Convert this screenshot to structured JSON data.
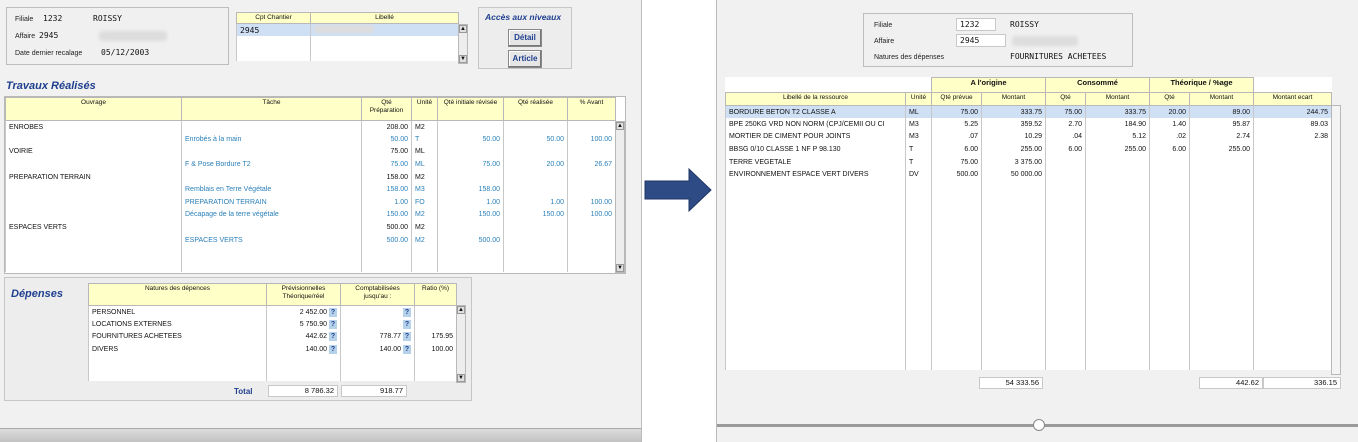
{
  "left": {
    "header": {
      "filiale_label": "Filiale",
      "filiale_code": "1232",
      "filiale_name": "ROISSY",
      "affaire_label": "Affaire",
      "affaire_code": "2945",
      "recalage_label": "Date dernier recalage",
      "recalage_date": "05/12/2003"
    },
    "chantier_table": {
      "columns": [
        "Cpt Chantier",
        "Libellé"
      ],
      "rows": [
        {
          "code": "2945"
        }
      ]
    },
    "acces": {
      "title": "Accès aux niveaux",
      "detail_button": "Détail",
      "article_button": "Article"
    },
    "travaux": {
      "title": "Travaux Réalisés",
      "columns": [
        "Ouvrage",
        "Tâche",
        "Qté Préparation",
        "Unité",
        "Qté initiale révisée",
        "Qté réalisée",
        "% Avant"
      ],
      "rows": [
        {
          "ouvrage": "ENROBES",
          "tache": "",
          "qte_prep": "208.00",
          "unite": "M2",
          "qte_init": "",
          "qte_real": "",
          "avant": ""
        },
        {
          "ouvrage": "",
          "tache": "Enrobés à la main",
          "qte_prep": "50.00",
          "unite": "T",
          "qte_init": "50.00",
          "qte_real": "50.00",
          "avant": "100.00"
        },
        {
          "ouvrage": "VOIRIE",
          "tache": "",
          "qte_prep": "75.00",
          "unite": "ML",
          "qte_init": "",
          "qte_real": "",
          "avant": ""
        },
        {
          "ouvrage": "",
          "tache": "F & Pose Bordure T2",
          "qte_prep": "75.00",
          "unite": "ML",
          "qte_init": "75.00",
          "qte_real": "20.00",
          "avant": "26.67"
        },
        {
          "ouvrage": "PREPARATION TERRAIN",
          "tache": "",
          "qte_prep": "158.00",
          "unite": "M2",
          "qte_init": "",
          "qte_real": "",
          "avant": ""
        },
        {
          "ouvrage": "",
          "tache": "Remblais en Terre Végétale",
          "qte_prep": "158.00",
          "unite": "M3",
          "qte_init": "158.00",
          "qte_real": "",
          "avant": ""
        },
        {
          "ouvrage": "",
          "tache": "PREPARATION TERRAIN",
          "qte_prep": "1.00",
          "unite": "FO",
          "qte_init": "1.00",
          "qte_real": "1.00",
          "avant": "100.00"
        },
        {
          "ouvrage": "",
          "tache": "Décapage de la terre végétale",
          "qte_prep": "150.00",
          "unite": "M2",
          "qte_init": "150.00",
          "qte_real": "150.00",
          "avant": "100.00"
        },
        {
          "ouvrage": "ESPACES VERTS",
          "tache": "",
          "qte_prep": "500.00",
          "unite": "M2",
          "qte_init": "",
          "qte_real": "",
          "avant": ""
        },
        {
          "ouvrage": "",
          "tache": "ESPACES VERTS",
          "qte_prep": "500.00",
          "unite": "M2",
          "qte_init": "500.00",
          "qte_real": "",
          "avant": ""
        }
      ]
    },
    "depenses": {
      "title": "Dépenses",
      "columns": [
        "Natures des dépences",
        "Prévisionnelles Théorique/réel",
        "Comptabilisées jusqu'au :",
        "Ratio (%)"
      ],
      "rows": [
        {
          "nature": "PERSONNEL",
          "prev": "2 452.00",
          "compta": "",
          "ratio": ""
        },
        {
          "nature": "LOCATIONS EXTERNES",
          "prev": "5 750.90",
          "compta": "",
          "ratio": ""
        },
        {
          "nature": "FOURNITURES ACHETEES",
          "prev": "442.62",
          "compta": "778.77",
          "ratio": "175.95"
        },
        {
          "nature": "DIVERS",
          "prev": "140.00",
          "compta": "140.00",
          "ratio": "100.00"
        }
      ],
      "q_mark": "?",
      "total_label": "Total",
      "total_prev": "8 786.32",
      "total_compta": "918.77"
    }
  },
  "right": {
    "header": {
      "filiale_label": "Filiale",
      "filiale_code": "1232",
      "filiale_name": "ROISSY",
      "affaire_label": "Affaire",
      "affaire_code": "2945",
      "nature_label": "Natures des dépenses",
      "nature_value": "FOURNITURES ACHETEES"
    },
    "groups": [
      "A l'origine",
      "Consommé",
      "Théorique / %age"
    ],
    "columns": [
      "Libellé de la ressource",
      "Unité",
      "Qté prévue",
      "Montant",
      "Qté",
      "Montant",
      "Qté",
      "Montant",
      "Montant ecart"
    ],
    "rows": [
      {
        "lib": "BORDURE BETON T2 CLASSE A",
        "unite": "ML",
        "qte_prev": "75.00",
        "mont_orig": "333.75",
        "qte_cons": "75.00",
        "mont_cons": "333.75",
        "qte_theo": "20.00",
        "mont_theo": "89.00",
        "ecart": "244.75"
      },
      {
        "lib": "BPE 250KG VRD NON NORM (CPJ/CEMII  OU CI",
        "unite": "M3",
        "qte_prev": "5.25",
        "mont_orig": "359.52",
        "qte_cons": "2.70",
        "mont_cons": "184.90",
        "qte_theo": "1.40",
        "mont_theo": "95.87",
        "ecart": "89.03"
      },
      {
        "lib": "MORTIER DE CIMENT POUR JOINTS",
        "unite": "M3",
        "qte_prev": ".07",
        "mont_orig": "10.29",
        "qte_cons": ".04",
        "mont_cons": "5.12",
        "qte_theo": ".02",
        "mont_theo": "2.74",
        "ecart": "2.38"
      },
      {
        "lib": "BBSG 0/10 CLASSE 1 NF P 98.130",
        "unite": "T",
        "qte_prev": "6.00",
        "mont_orig": "255.00",
        "qte_cons": "6.00",
        "mont_cons": "255.00",
        "qte_theo": "6.00",
        "mont_theo": "255.00",
        "ecart": ""
      },
      {
        "lib": "TERRE VEGETALE",
        "unite": "T",
        "qte_prev": "75.00",
        "mont_orig": "3 375.00",
        "qte_cons": "",
        "mont_cons": "",
        "qte_theo": "",
        "mont_theo": "",
        "ecart": ""
      },
      {
        "lib": "ENVIRONNEMENT ESPACE VERT DIVERS",
        "unite": "DV",
        "qte_prev": "500.00",
        "mont_orig": "50 000.00",
        "qte_cons": "",
        "mont_cons": "",
        "qte_theo": "",
        "mont_theo": "",
        "ecart": ""
      }
    ],
    "totals": {
      "mont_orig": "54 333.56",
      "mont_theo": "442.62",
      "ecart": "336.15"
    }
  },
  "colors": {
    "accent": "#1f3f8f",
    "header_bg": "#ffffc8",
    "link_blue": "#2a80b9",
    "selection": "#cfe0f5",
    "arrow": "#2f4b85"
  }
}
